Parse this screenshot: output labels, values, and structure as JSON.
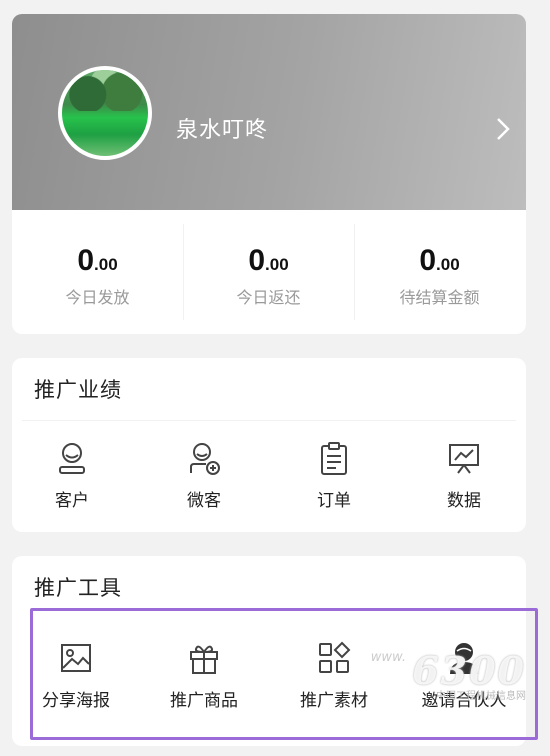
{
  "profile": {
    "name": "泉水叮咚"
  },
  "stats": [
    {
      "int": "0",
      "dec": ".00",
      "label": "今日发放"
    },
    {
      "int": "0",
      "dec": ".00",
      "label": "今日返还"
    },
    {
      "int": "0",
      "dec": ".00",
      "label": "待结算金额"
    }
  ],
  "performance": {
    "title": "推广业绩",
    "items": [
      {
        "label": "客户",
        "icon": "customer-icon"
      },
      {
        "label": "微客",
        "icon": "add-user-icon"
      },
      {
        "label": "订单",
        "icon": "order-icon"
      },
      {
        "label": "数据",
        "icon": "chart-icon"
      }
    ]
  },
  "tools": {
    "title": "推广工具",
    "items": [
      {
        "label": "分享海报",
        "icon": "image-icon"
      },
      {
        "label": "推广商品",
        "icon": "gift-icon"
      },
      {
        "label": "推广素材",
        "icon": "grid-icon"
      },
      {
        "label": "邀请合伙人",
        "icon": "partner-icon"
      }
    ]
  },
  "watermark": {
    "logo": "6300",
    "prefix": "www.",
    "site": "中国工程机械信息网"
  },
  "colors": {
    "highlight": "#9b6cd8",
    "header_gray": "#a0a0a0"
  }
}
